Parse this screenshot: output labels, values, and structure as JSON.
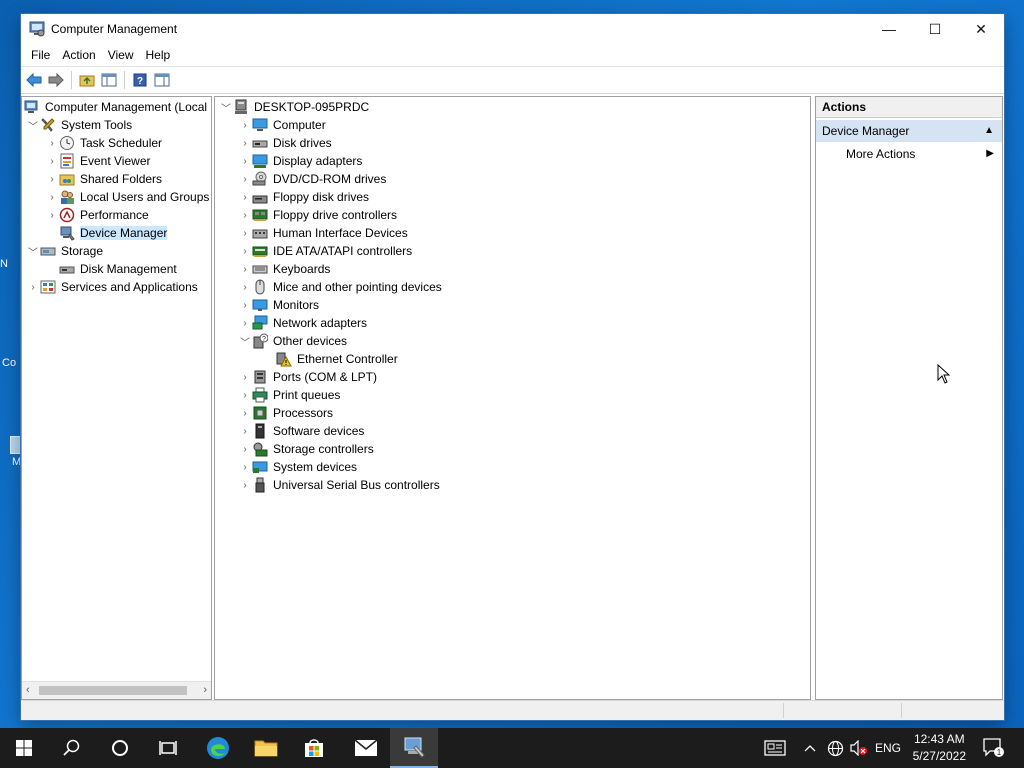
{
  "window": {
    "title": "Computer Management",
    "controls": {
      "minimize": "—",
      "maximize": "☐",
      "close": "✕"
    }
  },
  "menu": {
    "file": "File",
    "action": "Action",
    "view": "View",
    "help": "Help"
  },
  "tree": {
    "root": "Computer Management (Local",
    "system_tools": "System Tools",
    "task_scheduler": "Task Scheduler",
    "event_viewer": "Event Viewer",
    "shared_folders": "Shared Folders",
    "local_users": "Local Users and Groups",
    "performance": "Performance",
    "device_manager": "Device Manager",
    "storage": "Storage",
    "disk_management": "Disk Management",
    "services": "Services and Applications"
  },
  "devices": {
    "host": "DESKTOP-095PRDC",
    "computer": "Computer",
    "disk_drives": "Disk drives",
    "display_adapters": "Display adapters",
    "dvd": "DVD/CD-ROM drives",
    "floppy_disk": "Floppy disk drives",
    "floppy_ctrl": "Floppy drive controllers",
    "hid": "Human Interface Devices",
    "ide": "IDE ATA/ATAPI controllers",
    "keyboards": "Keyboards",
    "mice": "Mice and other pointing devices",
    "monitors": "Monitors",
    "network": "Network adapters",
    "other": "Other devices",
    "ethernet": "Ethernet Controller",
    "ports": "Ports (COM & LPT)",
    "print_queues": "Print queues",
    "processors": "Processors",
    "software": "Software devices",
    "storage_ctrl": "Storage controllers",
    "system_devices": "System devices",
    "usb": "Universal Serial Bus controllers"
  },
  "actions": {
    "header": "Actions",
    "section": "Device Manager",
    "more": "More Actions"
  },
  "taskbar": {
    "lang": "ENG",
    "time": "12:43 AM",
    "date": "5/27/2022",
    "notifications": "1"
  },
  "desktop": {
    "frag1": "N",
    "frag2": "Co",
    "frag3": "M"
  },
  "colors": {
    "accent": "#0078d7",
    "selection": "#cce8ff",
    "actions_section": "#d5e3f2"
  }
}
